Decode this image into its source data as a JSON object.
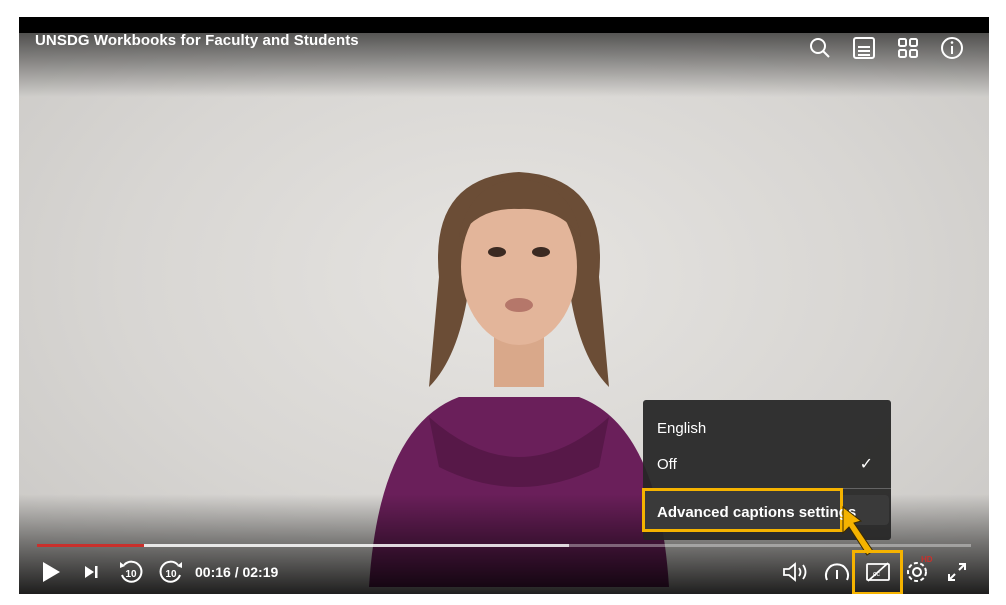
{
  "player": {
    "title": "UNSDG Workbooks for Faculty and Students",
    "top_icons": [
      "search-icon",
      "transcript-icon",
      "grid-icon",
      "info-icon"
    ]
  },
  "playback": {
    "current_time": "00:16",
    "separator": " / ",
    "duration": "02:19",
    "played_fraction": 0.115,
    "buffered_fraction": 0.57,
    "hd_badge": "HD"
  },
  "captions_menu": {
    "items": [
      {
        "label": "English",
        "selected": false
      },
      {
        "label": "Off",
        "selected": true
      }
    ],
    "check_mark": "✓",
    "advanced_label": "Advanced captions settings"
  },
  "colors": {
    "accent_highlight": "#f5b300",
    "progress_played": "#c9302c"
  }
}
